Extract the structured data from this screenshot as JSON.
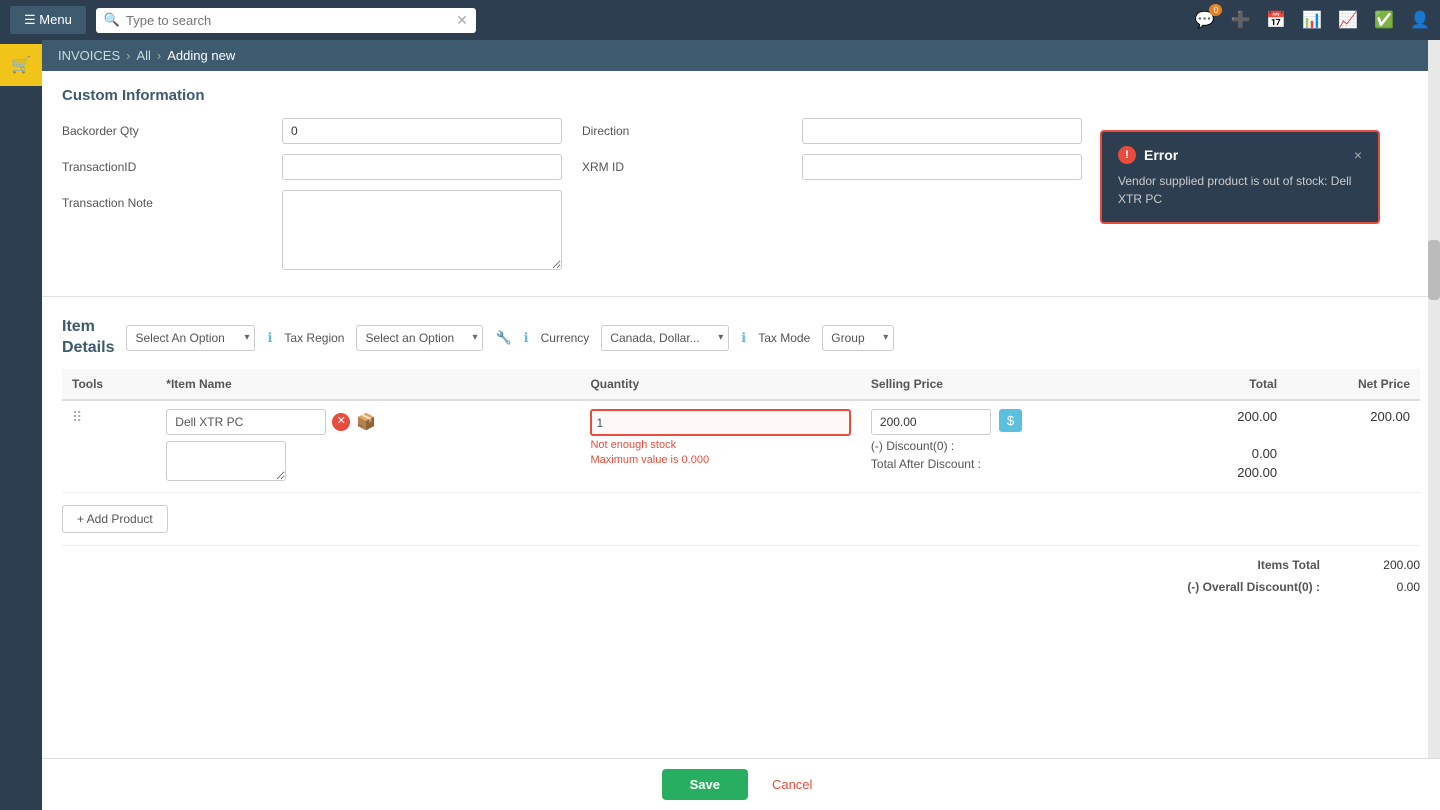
{
  "nav": {
    "menu_label": "Menu",
    "search_placeholder": "Type to search",
    "notification_count": "0"
  },
  "breadcrumb": {
    "root": "INVOICES",
    "level1": "All",
    "level2": "Adding new"
  },
  "custom_info": {
    "title": "Custom Information",
    "backorder_qty_label": "Backorder Qty",
    "backorder_qty_value": "0",
    "transaction_id_label": "TransactionID",
    "transaction_note_label": "Transaction Note",
    "direction_label": "Direction",
    "xrm_id_label": "XRM ID"
  },
  "item_details": {
    "title": "Item\nDetails",
    "select_option_placeholder": "Select An Option",
    "tax_region_label": "Tax Region",
    "tax_region_placeholder": "Select an Option",
    "currency_label": "Currency",
    "currency_value": "Canada, Dollar...",
    "tax_mode_label": "Tax Mode",
    "tax_mode_value": "Group"
  },
  "table": {
    "headers": {
      "tools": "Tools",
      "item_name": "*Item Name",
      "quantity": "Quantity",
      "selling_price": "Selling Price",
      "total": "Total",
      "net_price": "Net Price"
    },
    "row": {
      "product_name": "Dell XTR PC",
      "quantity": "1",
      "qty_error1": "Not enough stock",
      "qty_error2": "Maximum value is 0.000",
      "price": "200.00",
      "discount_label": "(-) Discount(0) :",
      "after_discount_label": "Total After Discount :",
      "total_value": "200.00",
      "discount_value": "0.00",
      "total_after_discount": "200.00",
      "net_price": "200.00"
    }
  },
  "add_product_label": "+ Add Product",
  "totals": {
    "items_total_label": "Items Total",
    "items_total_value": "200.00",
    "overall_discount_label": "(-) Overall Discount(0) :",
    "overall_discount_value": "0.00"
  },
  "actions": {
    "save_label": "Save",
    "cancel_label": "Cancel"
  },
  "error": {
    "title": "Error",
    "message": "Vendor supplied product is out of stock: Dell XTR PC",
    "close_label": "×"
  }
}
